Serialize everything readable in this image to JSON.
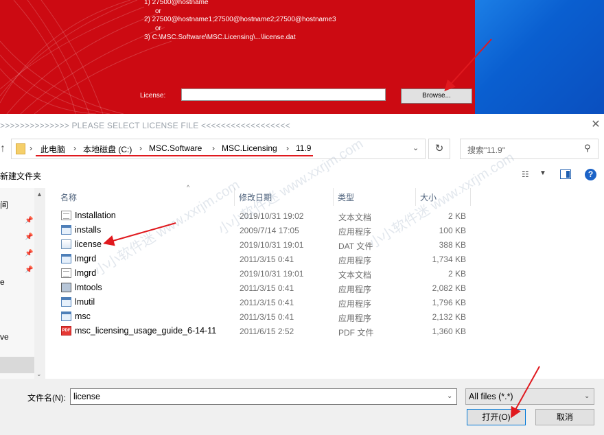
{
  "installer": {
    "option_1": "1) 27500@hostname",
    "or_1": "or",
    "option_2": "2) 27500@hostname1;27500@hostname2;27500@hostname3",
    "or_2": "or",
    "option_3": "3) C:\\MSC.Software\\MSC.Licensing\\...\\license.dat",
    "license_label": "License:",
    "license_value": "",
    "browse_label": "Browse...",
    "brand_color": "#cc0a12"
  },
  "dialog": {
    "title": ">>>>>>>>>>>>>>  PLEASE SELECT LICENSE FILE  <<<<<<<<<<<<<<<<<<",
    "close_icon": "close-icon",
    "breadcrumb": [
      "此电脑",
      "本地磁盘 (C:)",
      "MSC.Software",
      "MSC.Licensing",
      "11.9"
    ],
    "search_placeholder": "搜索\"11.9\"",
    "new_folder": "新建文件夹",
    "help": "?",
    "columns": {
      "name": "名称",
      "date": "修改日期",
      "type": "类型",
      "size": "大小"
    },
    "files": [
      {
        "name": "Installation",
        "date": "2019/10/31 19:02",
        "type": "文本文档",
        "size": "2 KB",
        "icon": "text-file-icon"
      },
      {
        "name": "installs",
        "date": "2009/7/14 17:05",
        "type": "应用程序",
        "size": "100 KB",
        "icon": "exe-icon"
      },
      {
        "name": "license",
        "date": "2019/10/31 19:01",
        "type": "DAT 文件",
        "size": "388 KB",
        "icon": "dat-file-icon"
      },
      {
        "name": "lmgrd",
        "date": "2011/3/15 0:41",
        "type": "应用程序",
        "size": "1,734 KB",
        "icon": "exe-icon"
      },
      {
        "name": "lmgrd",
        "date": "2019/10/31 19:01",
        "type": "文本文档",
        "size": "2 KB",
        "icon": "text-file-icon"
      },
      {
        "name": "lmtools",
        "date": "2011/3/15 0:41",
        "type": "应用程序",
        "size": "2,082 KB",
        "icon": "tool-icon"
      },
      {
        "name": "lmutil",
        "date": "2011/3/15 0:41",
        "type": "应用程序",
        "size": "1,796 KB",
        "icon": "exe-icon"
      },
      {
        "name": "msc",
        "date": "2011/3/15 0:41",
        "type": "应用程序",
        "size": "2,132 KB",
        "icon": "exe-icon"
      },
      {
        "name": "msc_licensing_usage_guide_6-14-11",
        "date": "2011/6/15 2:52",
        "type": "PDF 文件",
        "size": "1,360 KB",
        "icon": "pdf-icon"
      }
    ],
    "left_nav": [
      "间",
      "e",
      "ve"
    ],
    "filename_label": "文件名(N):",
    "filename_value": "license",
    "filter_value": "All files (*.*)",
    "open_label": "打开(O)",
    "cancel_label": "取消",
    "accent_color": "#0078d7",
    "annotation_color": "#e0191e"
  },
  "watermark": [
    "小小软件迷 www.xxrjm.com",
    "小小软件迷 www.xxrjm.com",
    "小小软件迷 www.xxrjm.com"
  ]
}
